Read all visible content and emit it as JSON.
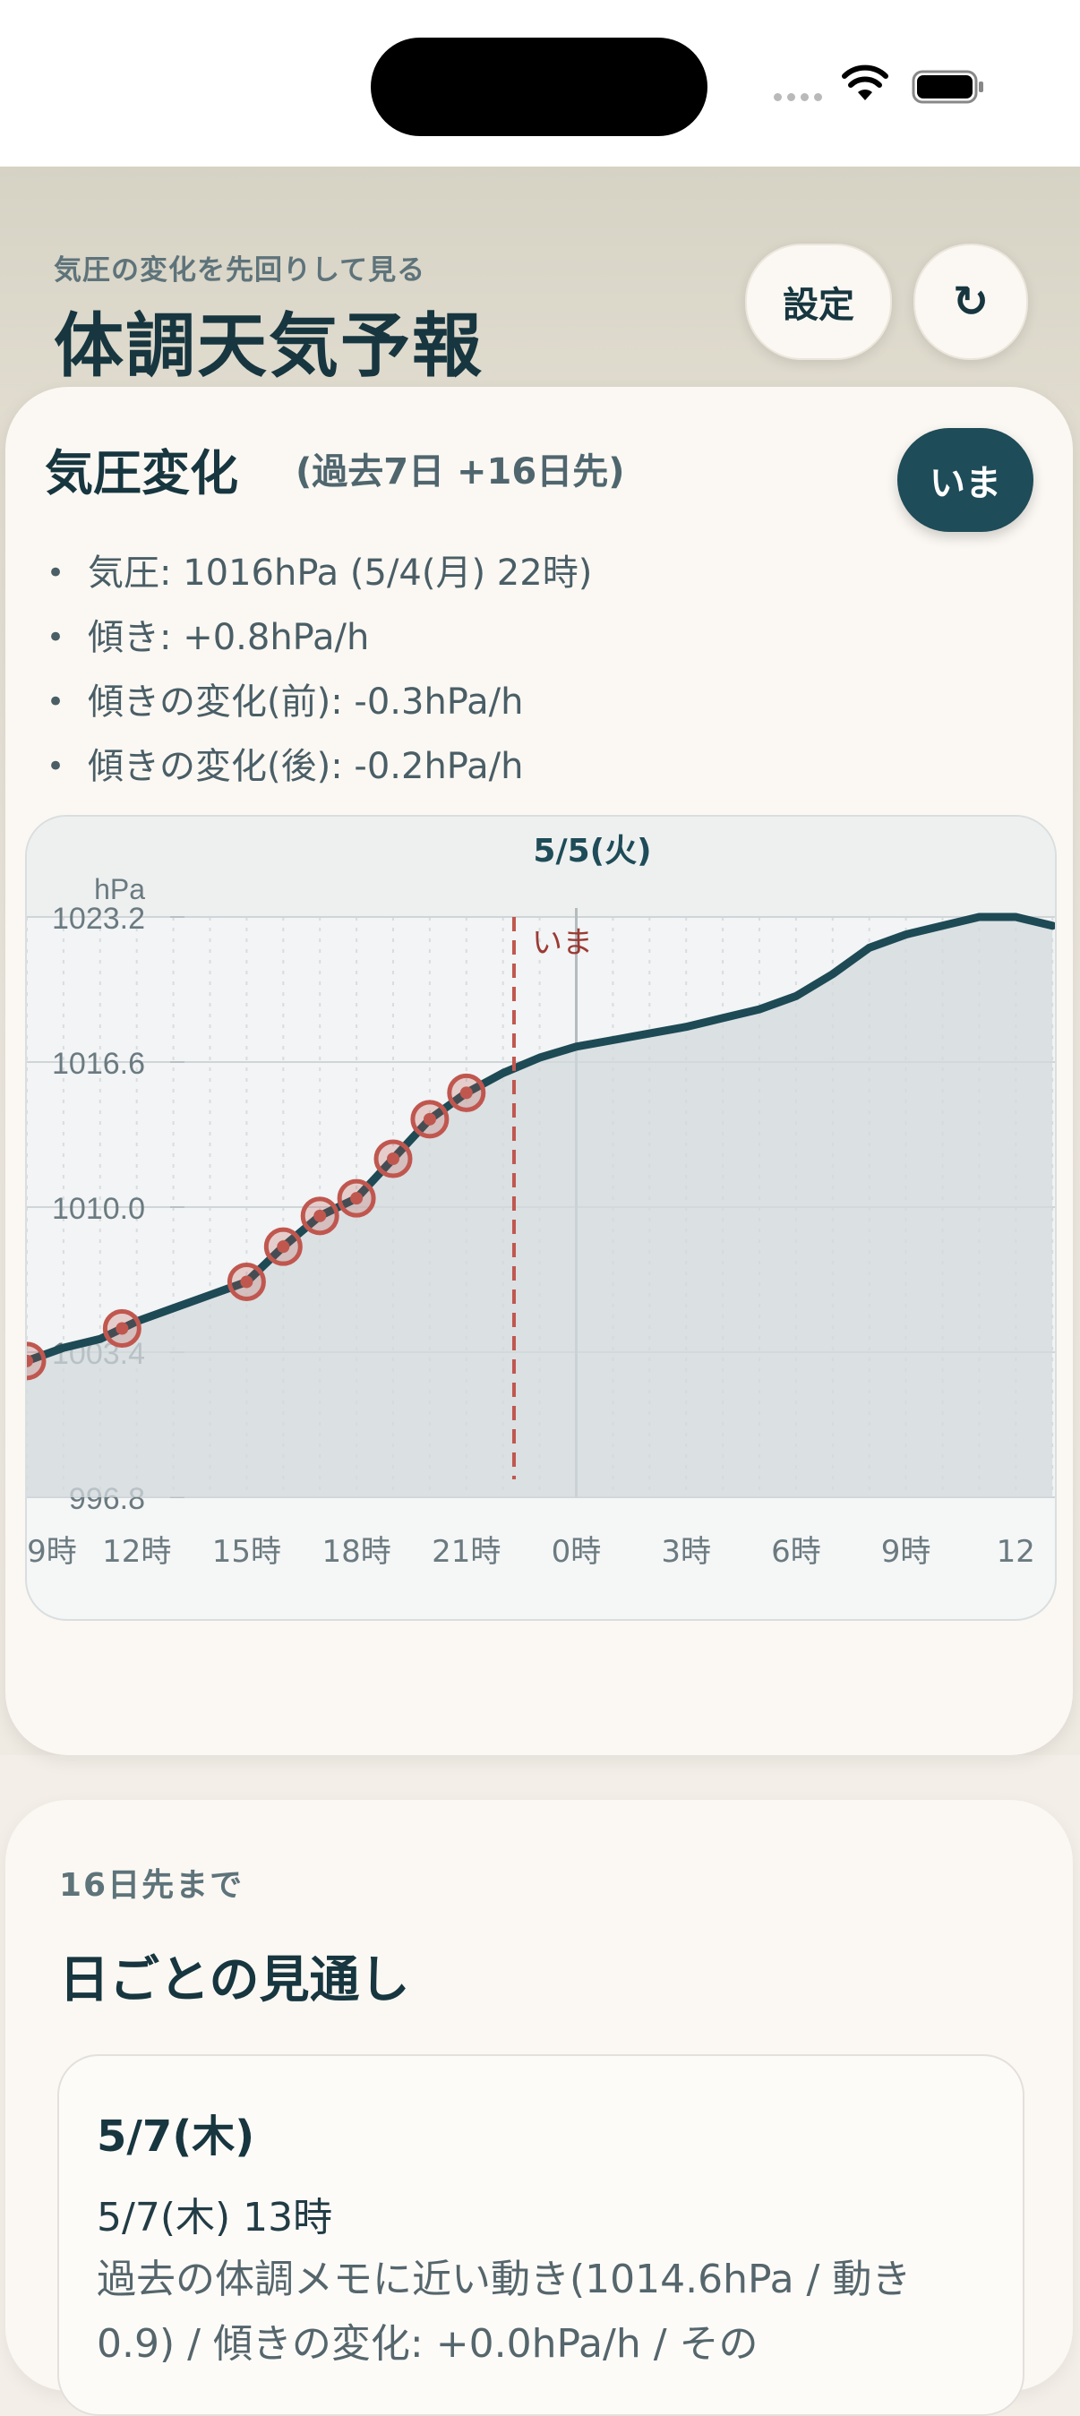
{
  "header": {
    "subtitle": "気圧の変化を先回りして見る",
    "title": "体調天気予報",
    "settings_label": "設定",
    "refresh_icon": "↻"
  },
  "pressure_card": {
    "title": "気圧変化",
    "title_sub": "(過去7日 +16日先)",
    "now_button": "いま",
    "stats": [
      "気圧: 1016hPa (5/4(月) 22時)",
      "傾き: +0.8hPa/h",
      "傾きの変化(前): -0.3hPa/h",
      "傾きの変化(後): -0.2hPa/h"
    ]
  },
  "chart_data": {
    "type": "area",
    "date_label": "5/5(火)",
    "unit_label": "hPa",
    "now_label": "いま",
    "ylim": [
      996.8,
      1023.2
    ],
    "y_ticks": [
      "1023.2",
      "1016.6",
      "1010.0",
      "1003.4",
      "996.8"
    ],
    "x_ticks": [
      "9時",
      "12時",
      "15時",
      "18時",
      "21時",
      "0時",
      "3時",
      "6時",
      "9時",
      "12"
    ],
    "x_start_hour": 9,
    "now_hour": 22.3,
    "series": [
      {
        "x": [
          9,
          10,
          11,
          12,
          13,
          14,
          15,
          16,
          17,
          18,
          19,
          20,
          21,
          22,
          23,
          24,
          25,
          26,
          27,
          28,
          29,
          30,
          31,
          32,
          33,
          34,
          35,
          36,
          37
        ],
        "values": [
          1003.0,
          1003.6,
          1004.0,
          1004.8,
          1005.4,
          1006.0,
          1006.6,
          1008.2,
          1009.6,
          1010.4,
          1012.2,
          1014.0,
          1015.2,
          1016.1,
          1016.8,
          1017.3,
          1017.6,
          1017.9,
          1018.2,
          1018.6,
          1019.0,
          1019.6,
          1020.6,
          1021.8,
          1022.4,
          1022.8,
          1023.2,
          1023.2,
          1022.8
        ]
      }
    ],
    "marked_points_x": [
      9,
      11.6,
      15.0,
      16.0,
      17.0,
      18.0,
      19.0,
      20.0,
      21.0
    ],
    "colors": {
      "line": "#1d4a55",
      "area": "#d3dadc",
      "marker": "#c0574f",
      "now_line": "#c0574f"
    }
  },
  "daily": {
    "subtitle": "16日先まで",
    "title": "日ごとの見通し",
    "items": [
      {
        "date": "5/7(木)",
        "time": "5/7(木) 13時",
        "description": "過去の体調メモに近い動き(1014.6hPa / 動き 0.9) / 傾きの変化: +0.0hPa/h / その"
      }
    ]
  }
}
